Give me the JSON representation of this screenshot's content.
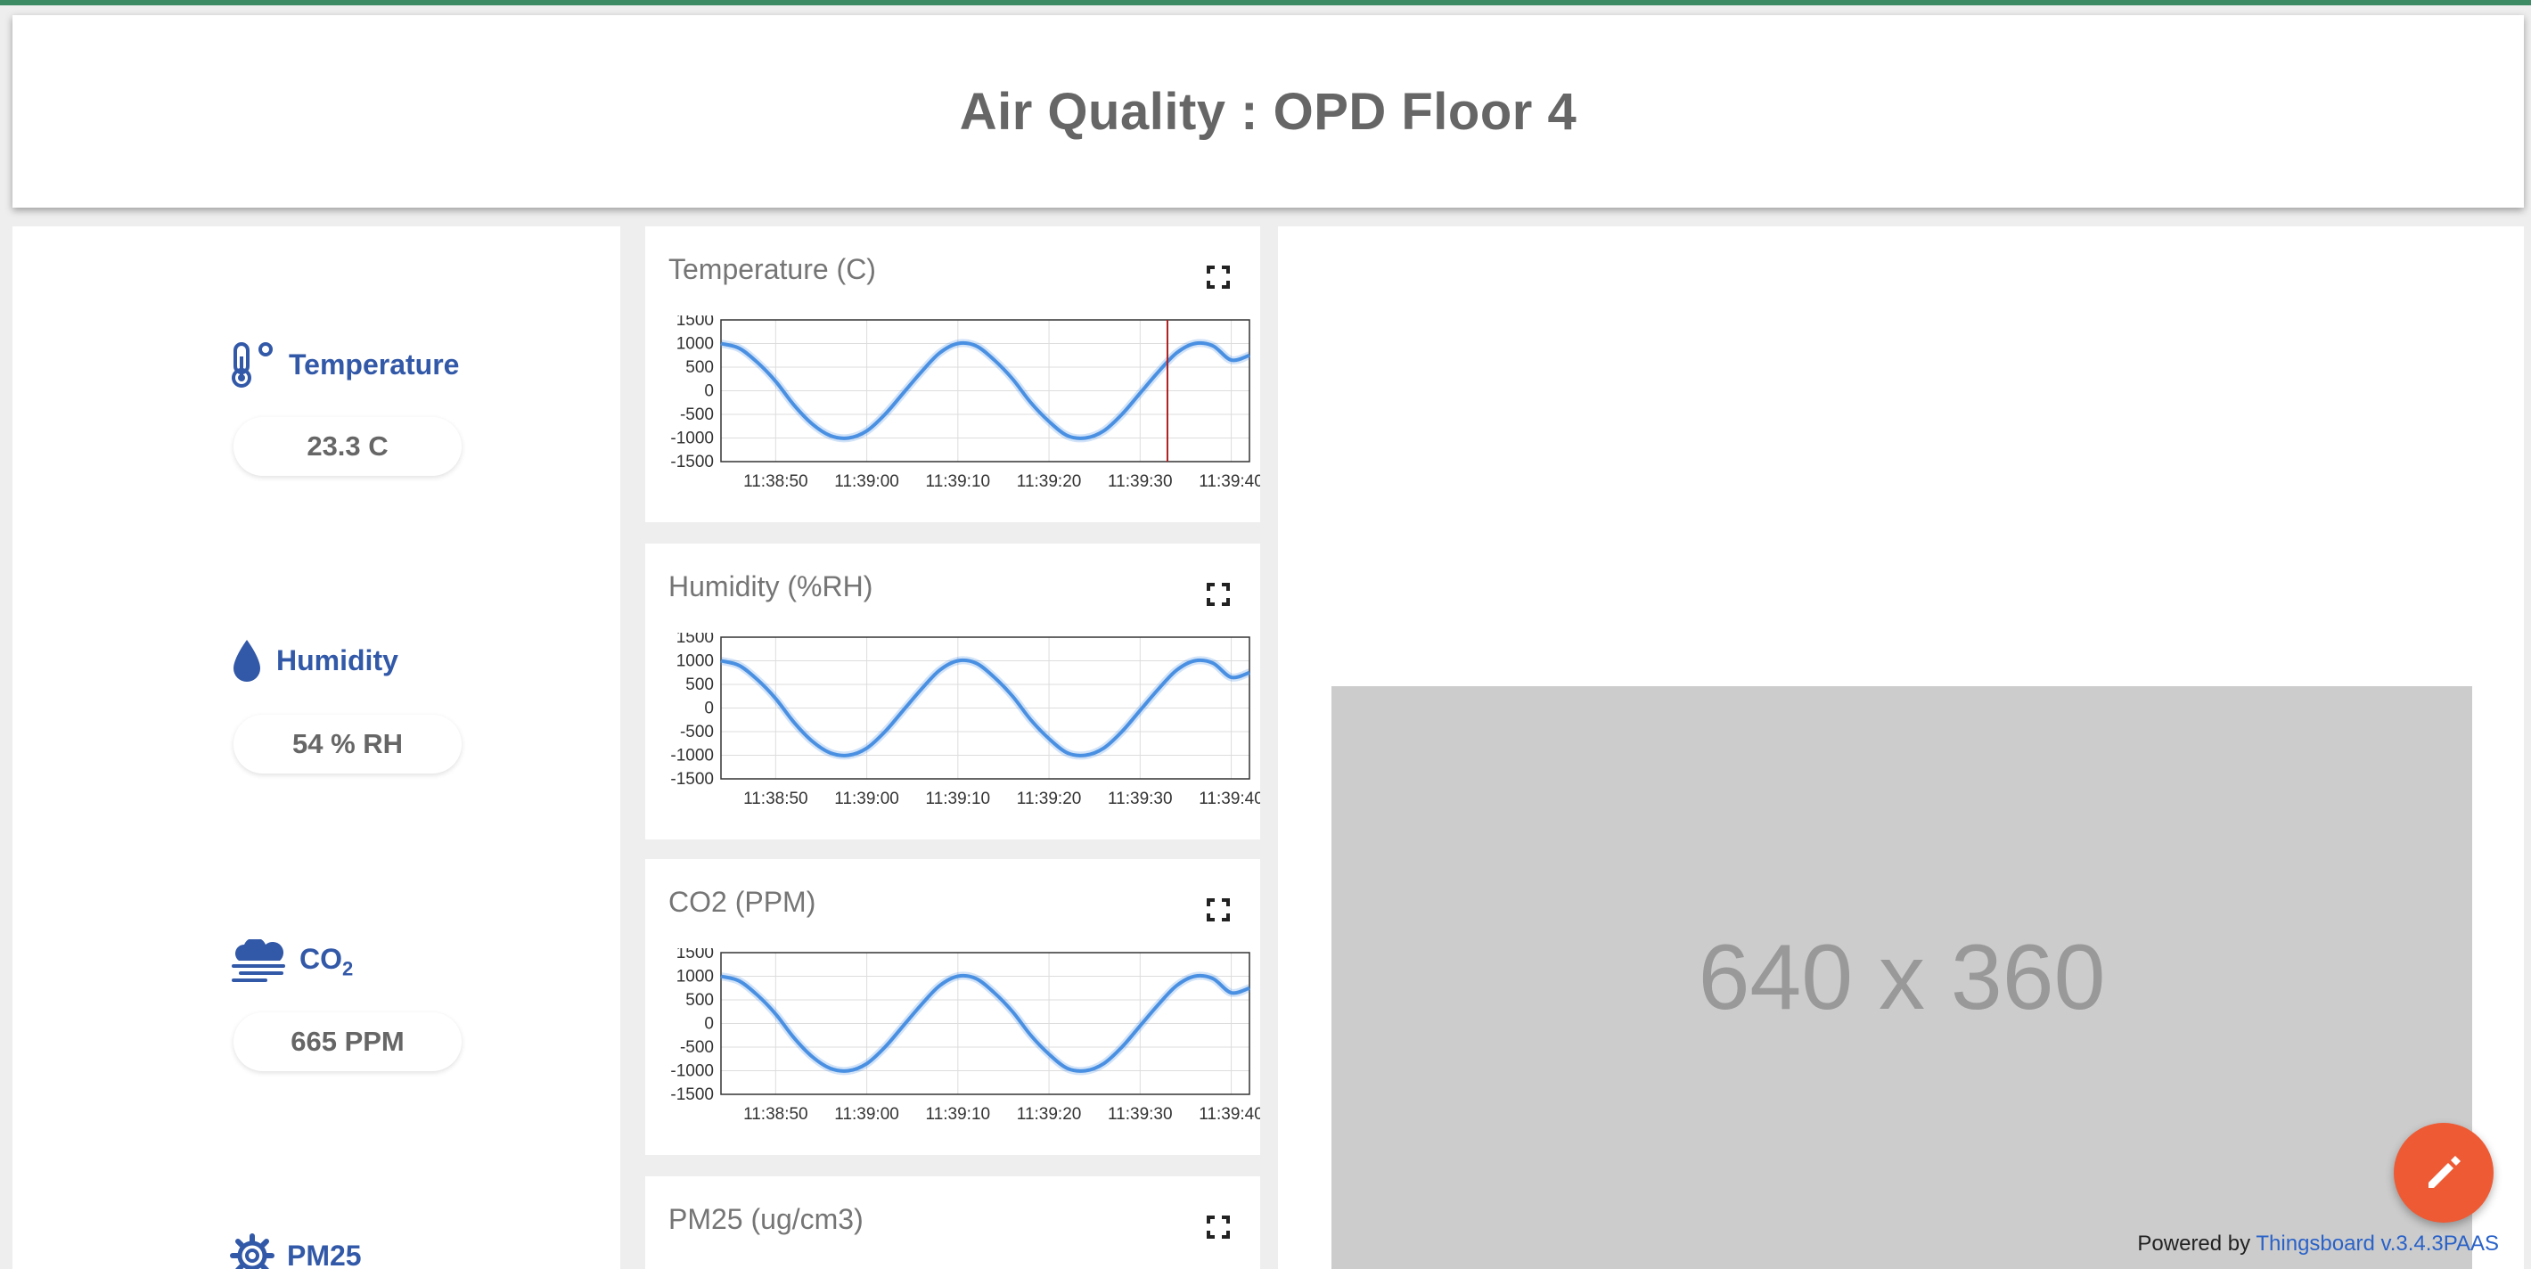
{
  "dashboard": {
    "title": "Air Quality : OPD Floor 4"
  },
  "metrics": [
    {
      "label": "Temperature",
      "value": "23.3 C",
      "icon": "thermometer-icon"
    },
    {
      "label": "Humidity",
      "value": "54 % RH",
      "icon": "water-drop-icon"
    },
    {
      "label": "CO",
      "subscript": "2",
      "value": "665 PPM",
      "icon": "cloud-fog-icon"
    },
    {
      "label": "PM25",
      "icon": "gear-icon"
    }
  ],
  "charts": [
    {
      "title": "Temperature (C)"
    },
    {
      "title": "Humidity (%RH)"
    },
    {
      "title": "CO2 (PPM)"
    },
    {
      "title": "PM25 (ug/cm3)"
    }
  ],
  "chart_data": [
    {
      "type": "line",
      "title": "Temperature (C)",
      "x": [
        "11:38:44",
        "11:38:46",
        "11:38:48",
        "11:38:50",
        "11:38:52",
        "11:38:54",
        "11:38:56",
        "11:38:58",
        "11:39:00",
        "11:39:02",
        "11:39:04",
        "11:39:06",
        "11:39:08",
        "11:39:10",
        "11:39:12",
        "11:39:14",
        "11:39:16",
        "11:39:18",
        "11:39:20",
        "11:39:22",
        "11:39:24",
        "11:39:26",
        "11:39:28",
        "11:39:30",
        "11:39:32",
        "11:39:34",
        "11:39:36",
        "11:39:38",
        "11:39:40",
        "11:39:42"
      ],
      "y": [
        1000,
        900,
        600,
        200,
        -300,
        -700,
        -950,
        -1000,
        -850,
        -500,
        -50,
        400,
        800,
        1000,
        950,
        650,
        250,
        -250,
        -650,
        -950,
        -1000,
        -850,
        -500,
        -50,
        400,
        800,
        1000,
        950,
        650,
        750
      ],
      "ylim": [
        -1500,
        1500
      ],
      "yticks": [
        1500,
        1000,
        500,
        0,
        -500,
        -1000,
        -1500
      ],
      "xticks": [
        "11:38:50",
        "11:39:00",
        "11:39:10",
        "11:39:20",
        "11:39:30",
        "11:39:40"
      ],
      "marker_line": "11:39:33",
      "grid": true,
      "color": "#4a90e2"
    },
    {
      "type": "line",
      "title": "Humidity (%RH)",
      "x": [
        "11:38:44",
        "11:38:46",
        "11:38:48",
        "11:38:50",
        "11:38:52",
        "11:38:54",
        "11:38:56",
        "11:38:58",
        "11:39:00",
        "11:39:02",
        "11:39:04",
        "11:39:06",
        "11:39:08",
        "11:39:10",
        "11:39:12",
        "11:39:14",
        "11:39:16",
        "11:39:18",
        "11:39:20",
        "11:39:22",
        "11:39:24",
        "11:39:26",
        "11:39:28",
        "11:39:30",
        "11:39:32",
        "11:39:34",
        "11:39:36",
        "11:39:38",
        "11:39:40",
        "11:39:42"
      ],
      "y": [
        1000,
        900,
        600,
        200,
        -300,
        -700,
        -950,
        -1000,
        -850,
        -500,
        -50,
        400,
        800,
        1000,
        950,
        650,
        250,
        -250,
        -650,
        -950,
        -1000,
        -850,
        -500,
        -50,
        400,
        800,
        1000,
        950,
        650,
        750
      ],
      "ylim": [
        -1500,
        1500
      ],
      "yticks": [
        1500,
        1000,
        500,
        0,
        -500,
        -1000,
        -1500
      ],
      "xticks": [
        "11:38:50",
        "11:39:00",
        "11:39:10",
        "11:39:20",
        "11:39:30",
        "11:39:40"
      ],
      "grid": true,
      "color": "#4a90e2"
    },
    {
      "type": "line",
      "title": "CO2 (PPM)",
      "x": [
        "11:38:44",
        "11:38:46",
        "11:38:48",
        "11:38:50",
        "11:38:52",
        "11:38:54",
        "11:38:56",
        "11:38:58",
        "11:39:00",
        "11:39:02",
        "11:39:04",
        "11:39:06",
        "11:39:08",
        "11:39:10",
        "11:39:12",
        "11:39:14",
        "11:39:16",
        "11:39:18",
        "11:39:20",
        "11:39:22",
        "11:39:24",
        "11:39:26",
        "11:39:28",
        "11:39:30",
        "11:39:32",
        "11:39:34",
        "11:39:36",
        "11:39:38",
        "11:39:40",
        "11:39:42"
      ],
      "y": [
        1000,
        900,
        600,
        200,
        -300,
        -700,
        -950,
        -1000,
        -850,
        -500,
        -50,
        400,
        800,
        1000,
        950,
        650,
        250,
        -250,
        -650,
        -950,
        -1000,
        -850,
        -500,
        -50,
        400,
        800,
        1000,
        950,
        650,
        750
      ],
      "ylim": [
        -1500,
        1500
      ],
      "yticks": [
        1500,
        1000,
        500,
        0,
        -500,
        -1000,
        -1500
      ],
      "xticks": [
        "11:38:50",
        "11:39:00",
        "11:39:10",
        "11:39:20",
        "11:39:30",
        "11:39:40"
      ],
      "grid": true,
      "color": "#4a90e2"
    }
  ],
  "image_placeholder": {
    "text": "640 x 360"
  },
  "footer": {
    "prefix": "Powered by",
    "link": "Thingsboard v.3.4.3PAAS"
  },
  "colors": {
    "accent": "#3258a8",
    "fab": "#ee5a34",
    "line": "#4a90e2",
    "marker": "#b02020"
  }
}
